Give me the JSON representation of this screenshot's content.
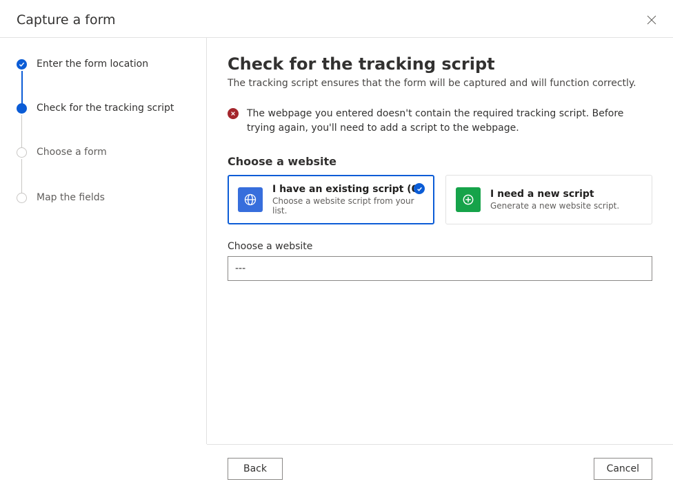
{
  "header": {
    "title": "Capture a form"
  },
  "steps": [
    {
      "label": "Enter the form location"
    },
    {
      "label": "Check for the tracking script"
    },
    {
      "label": "Choose a form"
    },
    {
      "label": "Map the fields"
    }
  ],
  "main": {
    "title": "Check for the tracking script",
    "description": "The tracking script ensures that the form will be captured and will function correctly.",
    "alert": "The webpage you entered doesn't contain the required tracking script. Before trying again, you'll need to add a script to the webpage.",
    "choose_section_label": "Choose a website",
    "cards": {
      "existing": {
        "title": "I have an existing script (0)",
        "sub": "Choose a website script from your list."
      },
      "new": {
        "title": "I need a new script",
        "sub": "Generate a new website script."
      }
    },
    "website_field_label": "Choose a website",
    "website_value": "---"
  },
  "footer": {
    "back": "Back",
    "cancel": "Cancel"
  }
}
